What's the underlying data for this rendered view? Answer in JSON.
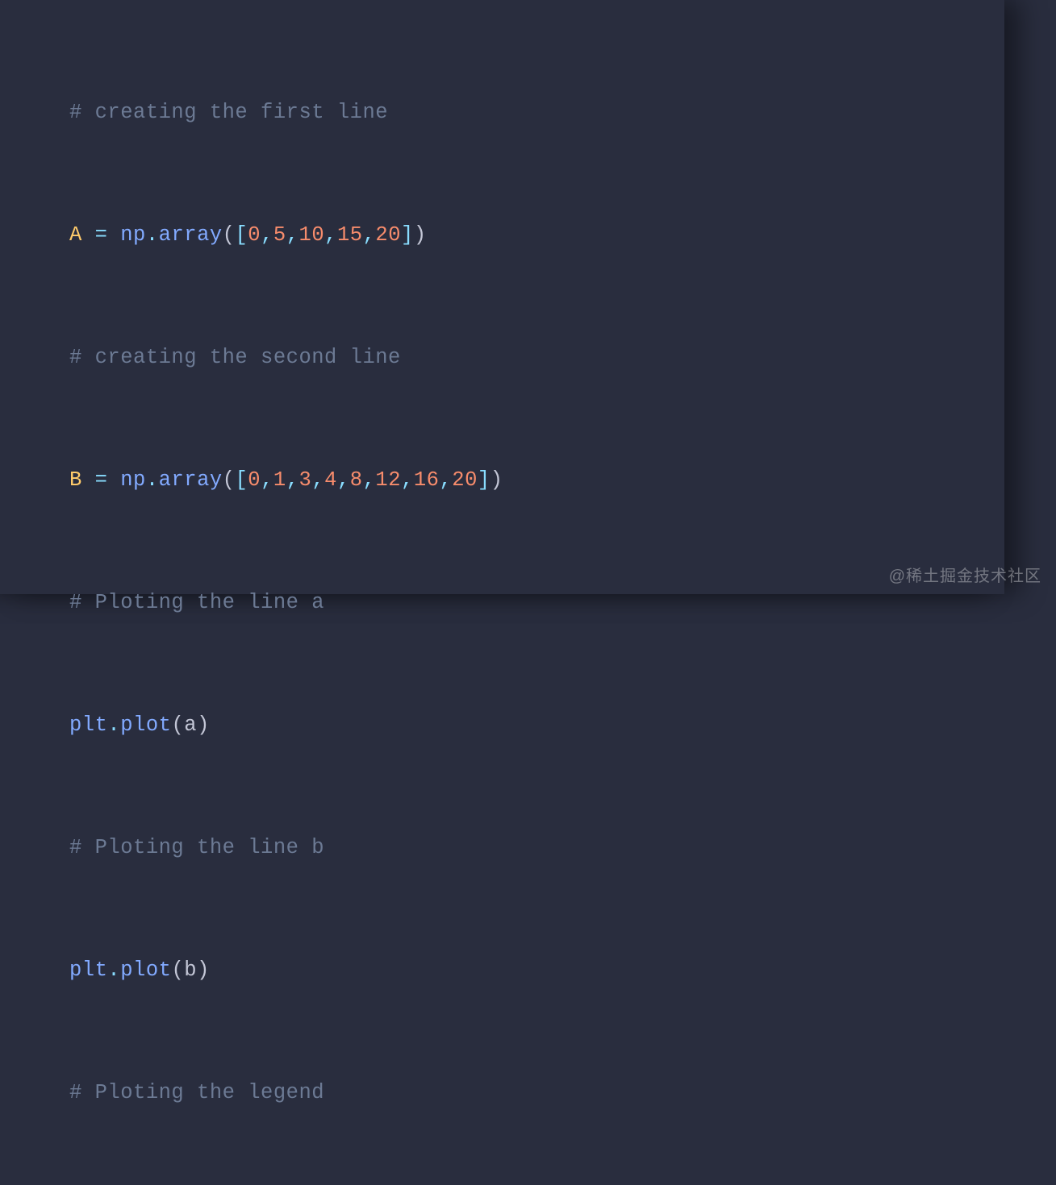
{
  "code": {
    "lines": [
      {
        "type": "partial_top"
      },
      {
        "type": "blank"
      },
      {
        "type": "comment",
        "text": "# creating the first line"
      },
      {
        "type": "blank"
      },
      {
        "type": "assign_array",
        "var": "A",
        "values": [
          "0",
          "5",
          "10",
          "15",
          "20"
        ]
      },
      {
        "type": "blank"
      },
      {
        "type": "comment",
        "text": "# creating the second line"
      },
      {
        "type": "blank"
      },
      {
        "type": "assign_array",
        "var": "B",
        "values": [
          "0",
          "1",
          "3",
          "4",
          "8",
          "12",
          "16",
          "20"
        ]
      },
      {
        "type": "blank"
      },
      {
        "type": "comment",
        "text": "# Ploting the line a"
      },
      {
        "type": "blank"
      },
      {
        "type": "call_plot",
        "arg": "a"
      },
      {
        "type": "blank"
      },
      {
        "type": "comment",
        "text": "# Ploting the line b"
      },
      {
        "type": "blank"
      },
      {
        "type": "call_plot",
        "arg": "b"
      },
      {
        "type": "blank"
      },
      {
        "type": "comment",
        "text": "# Ploting the legend"
      },
      {
        "type": "blank"
      }
    ],
    "tokens": {
      "np": "np",
      "array": "array",
      "plt": "plt",
      "plot": "plot",
      "eq": " = ",
      "dot": ".",
      "lpar": "(",
      "rpar": ")",
      "lbr": "[",
      "rbr": "]",
      "comma": ","
    }
  },
  "watermark": "@稀土掘金技术社区"
}
